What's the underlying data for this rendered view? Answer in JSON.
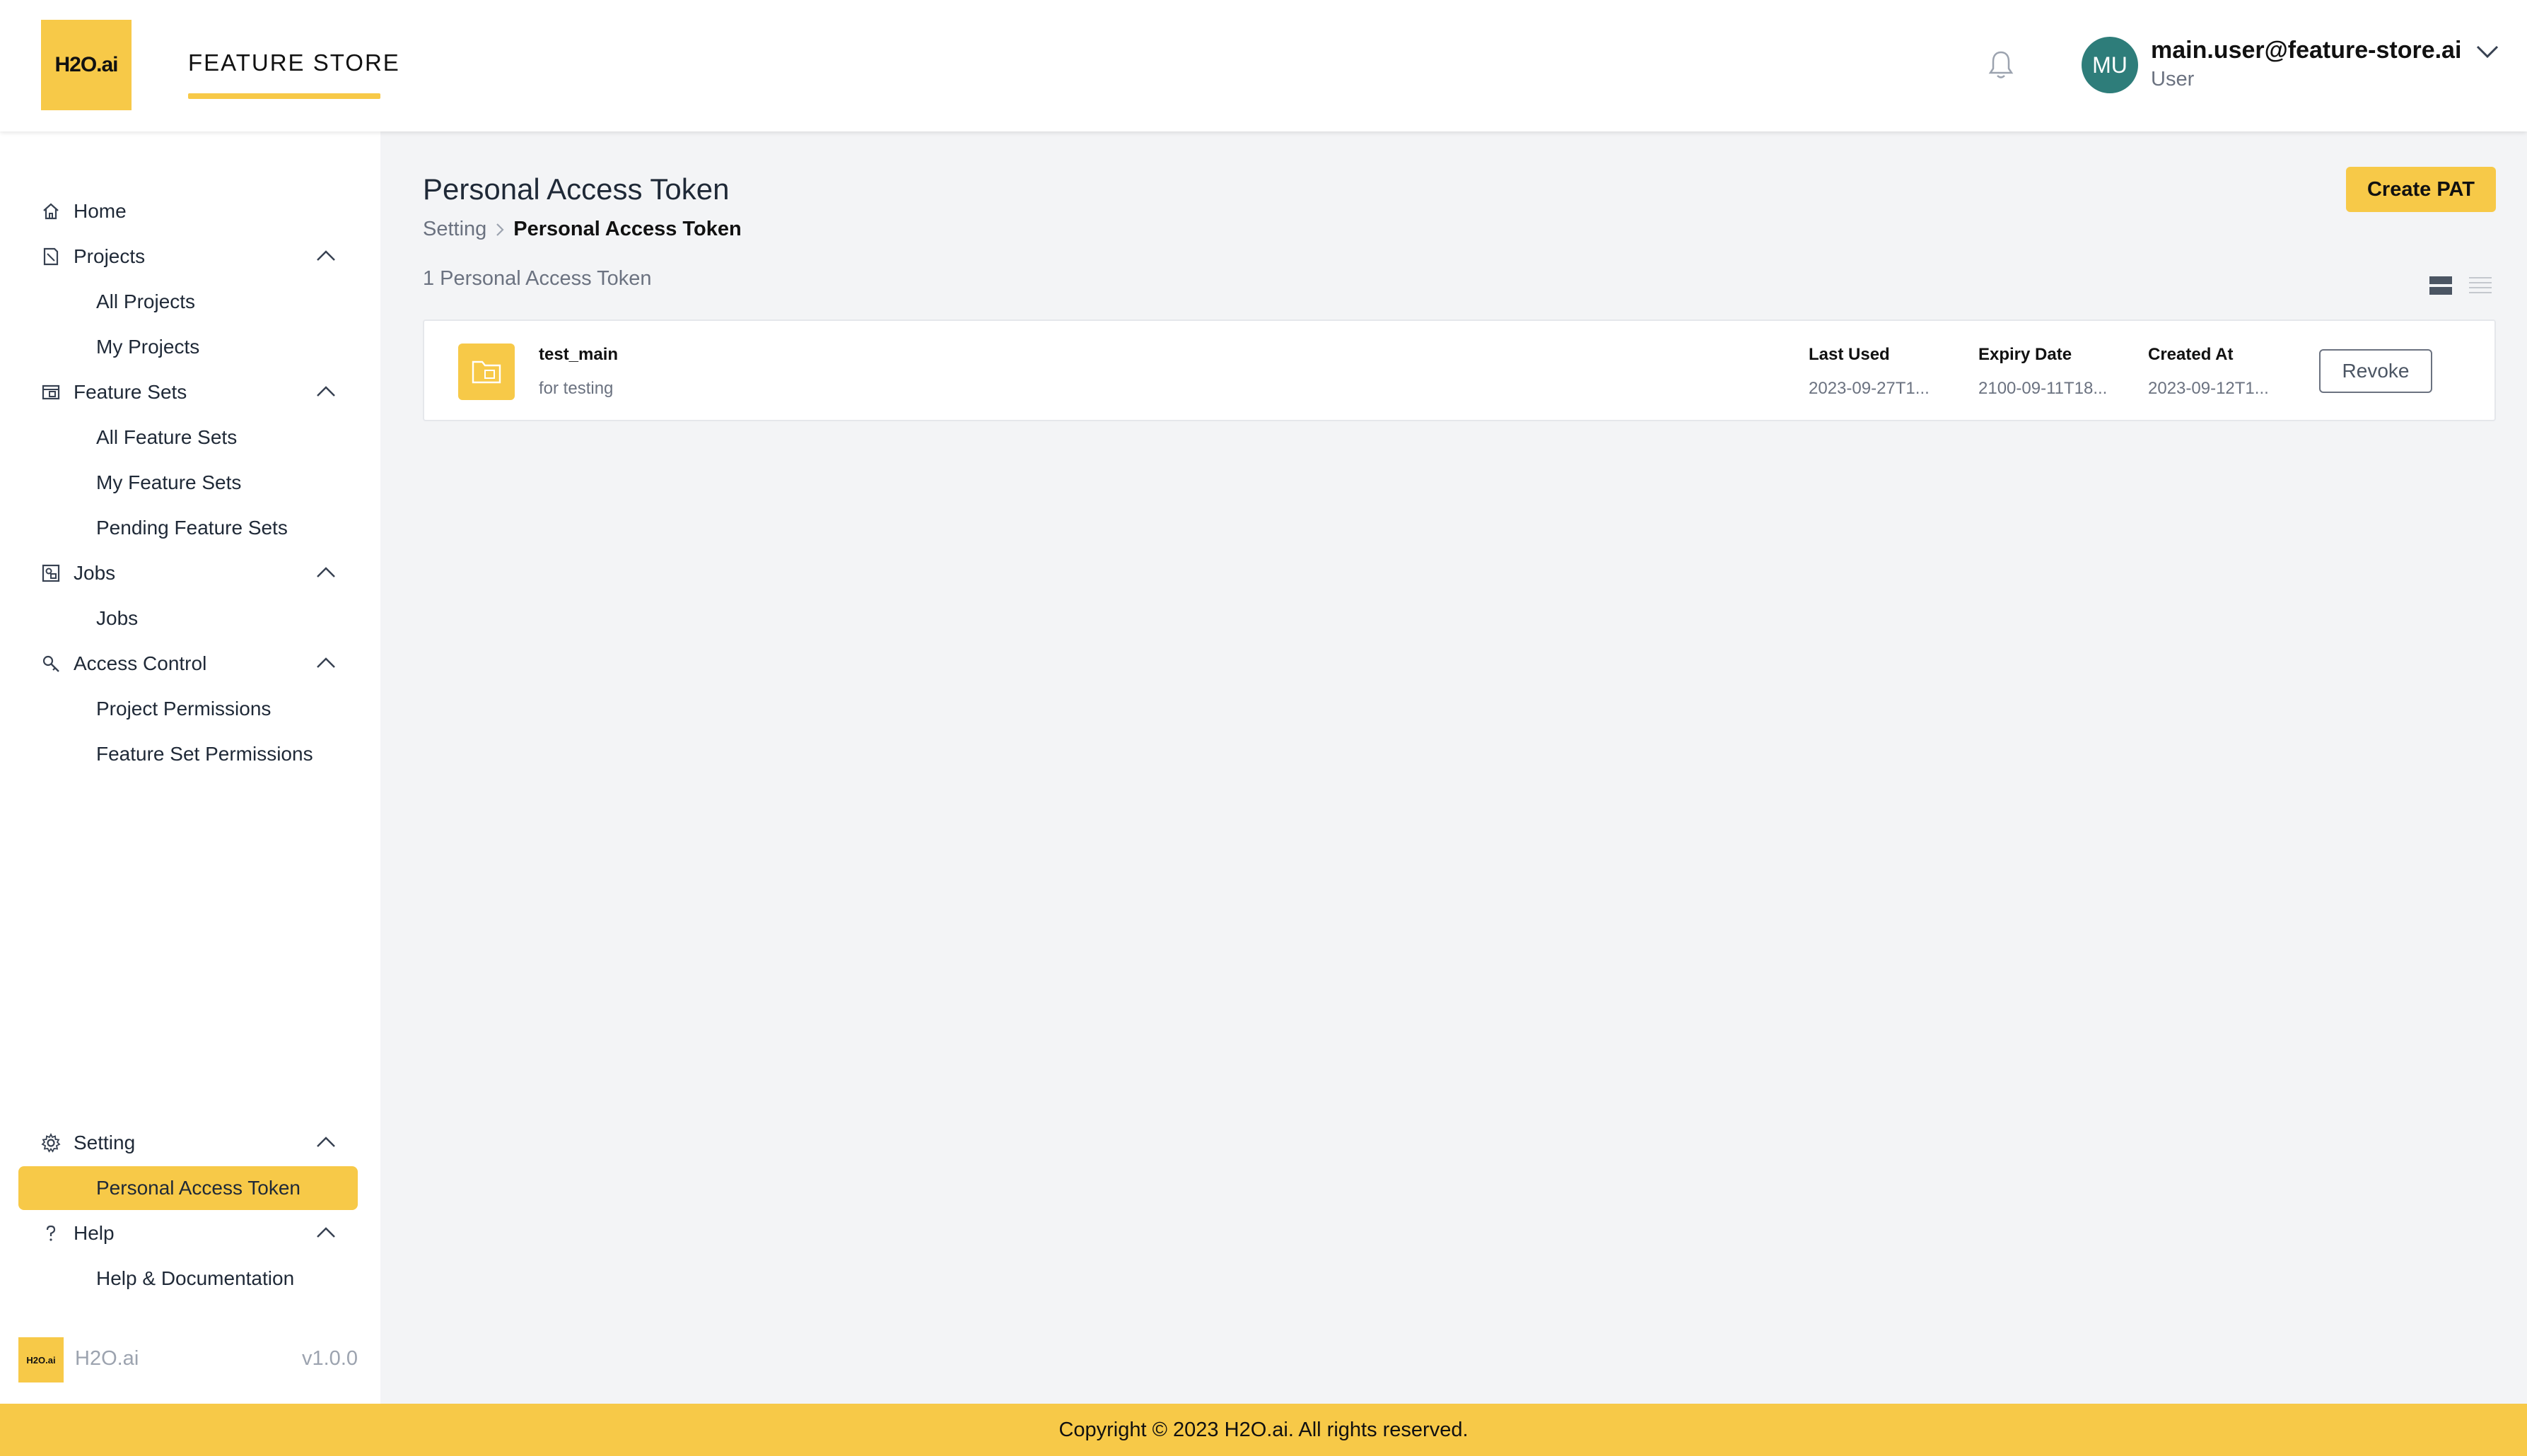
{
  "header": {
    "logo_text": "H2O.ai",
    "app_title": "FEATURE STORE",
    "user": {
      "initials": "MU",
      "email": "main.user@feature-store.ai",
      "role": "User"
    }
  },
  "sidebar": {
    "home": "Home",
    "projects": {
      "label": "Projects",
      "items": [
        "All Projects",
        "My Projects"
      ]
    },
    "feature_sets": {
      "label": "Feature Sets",
      "items": [
        "All Feature Sets",
        "My Feature Sets",
        "Pending Feature Sets"
      ]
    },
    "jobs": {
      "label": "Jobs",
      "items": [
        "Jobs"
      ]
    },
    "access_control": {
      "label": "Access Control",
      "items": [
        "Project Permissions",
        "Feature Set Permissions"
      ]
    },
    "setting": {
      "label": "Setting",
      "items": [
        "Personal Access Token"
      ]
    },
    "help": {
      "label": "Help",
      "items": [
        "Help & Documentation"
      ]
    },
    "footer": {
      "logo_text": "H2O.ai",
      "name": "H2O.ai",
      "version": "v1.0.0"
    }
  },
  "main": {
    "title": "Personal Access Token",
    "create_button": "Create PAT",
    "breadcrumb": {
      "parent": "Setting",
      "current": "Personal Access Token"
    },
    "count_label": "1 Personal Access Token",
    "tokens": [
      {
        "name": "test_main",
        "description": "for testing",
        "last_used_label": "Last Used",
        "last_used": "2023-09-27T1...",
        "expiry_label": "Expiry Date",
        "expiry": "2100-09-11T18...",
        "created_label": "Created At",
        "created": "2023-09-12T1...",
        "revoke_label": "Revoke"
      }
    ]
  },
  "footer": {
    "copyright": "Copyright © 2023 H2O.ai. All rights reserved."
  },
  "colors": {
    "accent": "#f7c948",
    "avatar": "#2e7d7a",
    "background": "#f3f4f6"
  },
  "icons": [
    "bell-icon",
    "chevron-down-icon",
    "home-icon",
    "projects-icon",
    "feature-sets-icon",
    "jobs-icon",
    "access-control-icon",
    "gear-icon",
    "help-icon",
    "chevron-up-icon",
    "chevron-right-icon",
    "card-view-icon",
    "list-view-icon",
    "folder-icon"
  ]
}
